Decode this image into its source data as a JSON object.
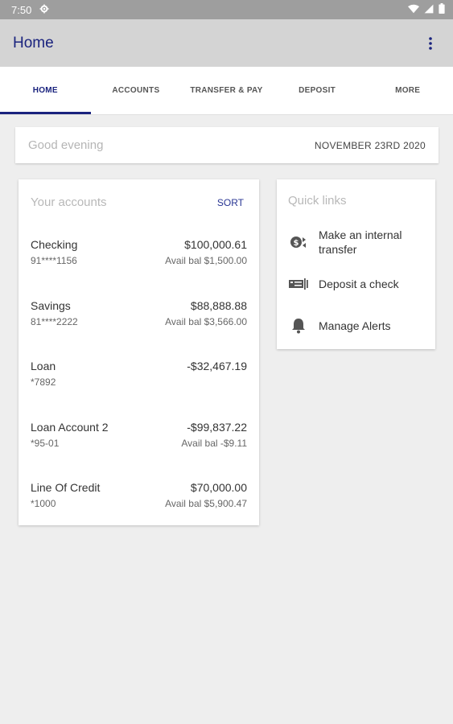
{
  "status_bar": {
    "time": "7:50"
  },
  "app_bar": {
    "title": "Home"
  },
  "tabs": [
    {
      "label": "HOME",
      "active": true
    },
    {
      "label": "ACCOUNTS",
      "active": false
    },
    {
      "label": "TRANSFER & PAY",
      "active": false
    },
    {
      "label": "DEPOSIT",
      "active": false
    },
    {
      "label": "MORE",
      "active": false
    }
  ],
  "greeting": {
    "text": "Good evening",
    "date": "NOVEMBER 23RD 2020"
  },
  "accounts": {
    "title": "Your accounts",
    "sort_label": "SORT",
    "items": [
      {
        "name": "Checking",
        "number": "91****1156",
        "amount": "$100,000.61",
        "avail": "Avail bal $1,500.00"
      },
      {
        "name": "Savings",
        "number": "81****2222",
        "amount": "$88,888.88",
        "avail": "Avail bal $3,566.00"
      },
      {
        "name": "Loan",
        "number": "*7892",
        "amount": "-$32,467.19",
        "avail": ""
      },
      {
        "name": "Loan Account 2",
        "number": "*95-01",
        "amount": "-$99,837.22",
        "avail": "Avail bal -$9.11"
      },
      {
        "name": "Line Of Credit",
        "number": "*1000",
        "amount": "$70,000.00",
        "avail": "Avail bal $5,900.47"
      }
    ]
  },
  "quick_links": {
    "title": "Quick links",
    "items": [
      {
        "label": "Make an internal transfer",
        "icon": "transfer-icon"
      },
      {
        "label": "Deposit a check",
        "icon": "check-icon"
      },
      {
        "label": "Manage Alerts",
        "icon": "bell-icon"
      }
    ]
  },
  "colors": {
    "brand": "#1a237e",
    "app_bar": "#d4d4d4",
    "status_bar": "#9e9e9e",
    "background": "#eeeeee"
  }
}
